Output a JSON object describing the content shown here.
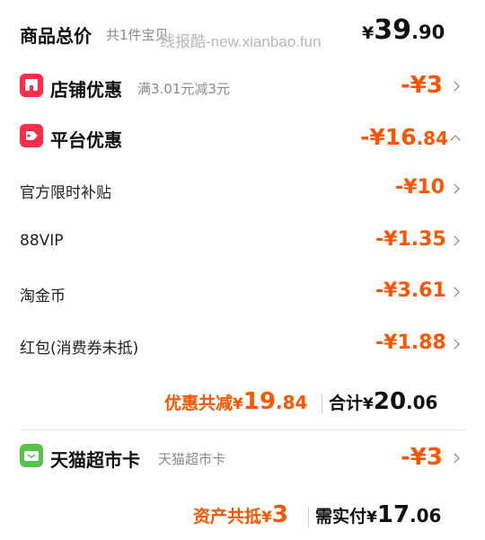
{
  "summary": {
    "title": "商品总价",
    "count_text": "共1件宝贝",
    "watermark": "线报酷-new.xianbao.fun",
    "currency": "¥",
    "price_int": "39",
    "price_dec": ".90"
  },
  "shop_discount": {
    "title": "店铺优惠",
    "desc": "满3.01元减3元",
    "amount": "-¥3"
  },
  "platform_discount": {
    "title": "平台优惠",
    "amount_int": "-¥16",
    "amount_dec": ".84",
    "items": [
      {
        "label": "官方限时补贴",
        "amount": "-¥10"
      },
      {
        "label": "88VIP",
        "amount": "-¥1.35"
      },
      {
        "label": "淘金币",
        "amount": "-¥3.61"
      },
      {
        "label": "红包(消费券未抵)",
        "amount": "-¥1.88"
      }
    ]
  },
  "totals": {
    "discount_label": "优惠共减",
    "discount_currency": "¥",
    "discount_int": "19",
    "discount_dec": ".84",
    "total_label": "合计",
    "total_currency": "¥",
    "total_int": "20",
    "total_dec": ".06"
  },
  "supermarket_card": {
    "title": "天猫超市卡",
    "desc": "天猫超市卡",
    "amount": "-¥3"
  },
  "final": {
    "asset_label": "资产共抵",
    "asset_currency": "¥",
    "asset_amount": "3",
    "pay_label": "需实付",
    "pay_currency": "¥",
    "pay_int": "17",
    "pay_dec": ".06"
  },
  "colors": {
    "accent": "#ff5500",
    "icon_red": "#ff2d4a",
    "icon_green": "#58c34b"
  }
}
